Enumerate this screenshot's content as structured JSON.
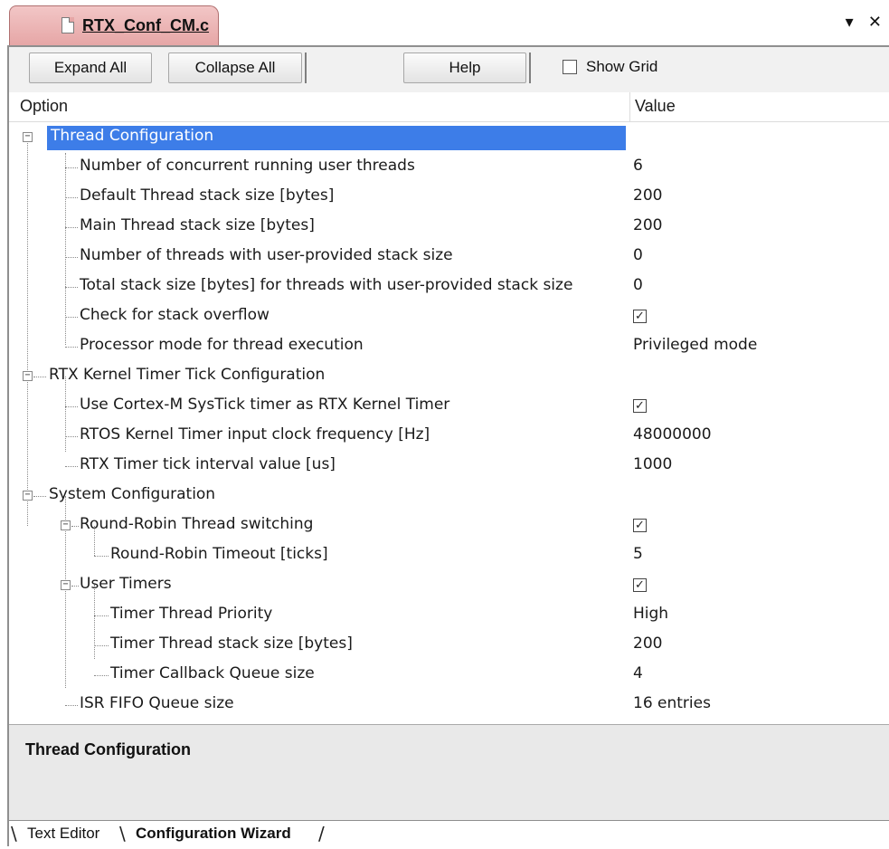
{
  "document_tab": {
    "title": "RTX_Conf_CM.c"
  },
  "pane_controls": {
    "dropdown": "▾",
    "close": "✕"
  },
  "toolbar": {
    "expand_all": "Expand All",
    "collapse_all": "Collapse All",
    "help": "Help",
    "show_grid": "Show Grid"
  },
  "columns": {
    "option": "Option",
    "value": "Value"
  },
  "tree": {
    "thread_config": {
      "label": "Thread Configuration",
      "items": [
        {
          "label": "Number of concurrent running user threads",
          "value": "6"
        },
        {
          "label": "Default Thread stack size [bytes]",
          "value": "200"
        },
        {
          "label": "Main Thread stack size [bytes]",
          "value": "200"
        },
        {
          "label": "Number of threads with user-provided stack size",
          "value": "0"
        },
        {
          "label": "Total stack size [bytes] for threads with user-provided stack size",
          "value": "0"
        },
        {
          "label": "Check for stack overflow",
          "value": "checked"
        },
        {
          "label": "Processor mode for thread execution",
          "value": "Privileged mode"
        }
      ]
    },
    "timer_tick_config": {
      "label": "RTX Kernel Timer Tick Configuration",
      "items": [
        {
          "label": "Use Cortex-M SysTick timer as RTX Kernel Timer",
          "value": "checked"
        },
        {
          "label": "RTOS Kernel Timer input clock frequency [Hz]",
          "value": "48000000"
        },
        {
          "label": "RTX Timer tick interval value [us]",
          "value": "1000"
        }
      ]
    },
    "system_config": {
      "label": "System Configuration",
      "round_robin": {
        "label": "Round-Robin Thread switching",
        "value": "checked",
        "timeout": {
          "label": "Round-Robin Timeout [ticks]",
          "value": "5"
        }
      },
      "user_timers": {
        "label": "User Timers",
        "value": "checked",
        "items": [
          {
            "label": "Timer Thread Priority",
            "value": "High"
          },
          {
            "label": "Timer Thread stack size [bytes]",
            "value": "200"
          },
          {
            "label": "Timer Callback Queue size",
            "value": "4"
          }
        ]
      },
      "isr_fifo": {
        "label": "ISR FIFO Queue size",
        "value": "16 entries"
      }
    }
  },
  "description": {
    "title": "Thread Configuration"
  },
  "bottom_tabs": {
    "text_editor": "Text Editor",
    "config_wizard": "Configuration Wizard"
  },
  "check_glyph": "✓"
}
